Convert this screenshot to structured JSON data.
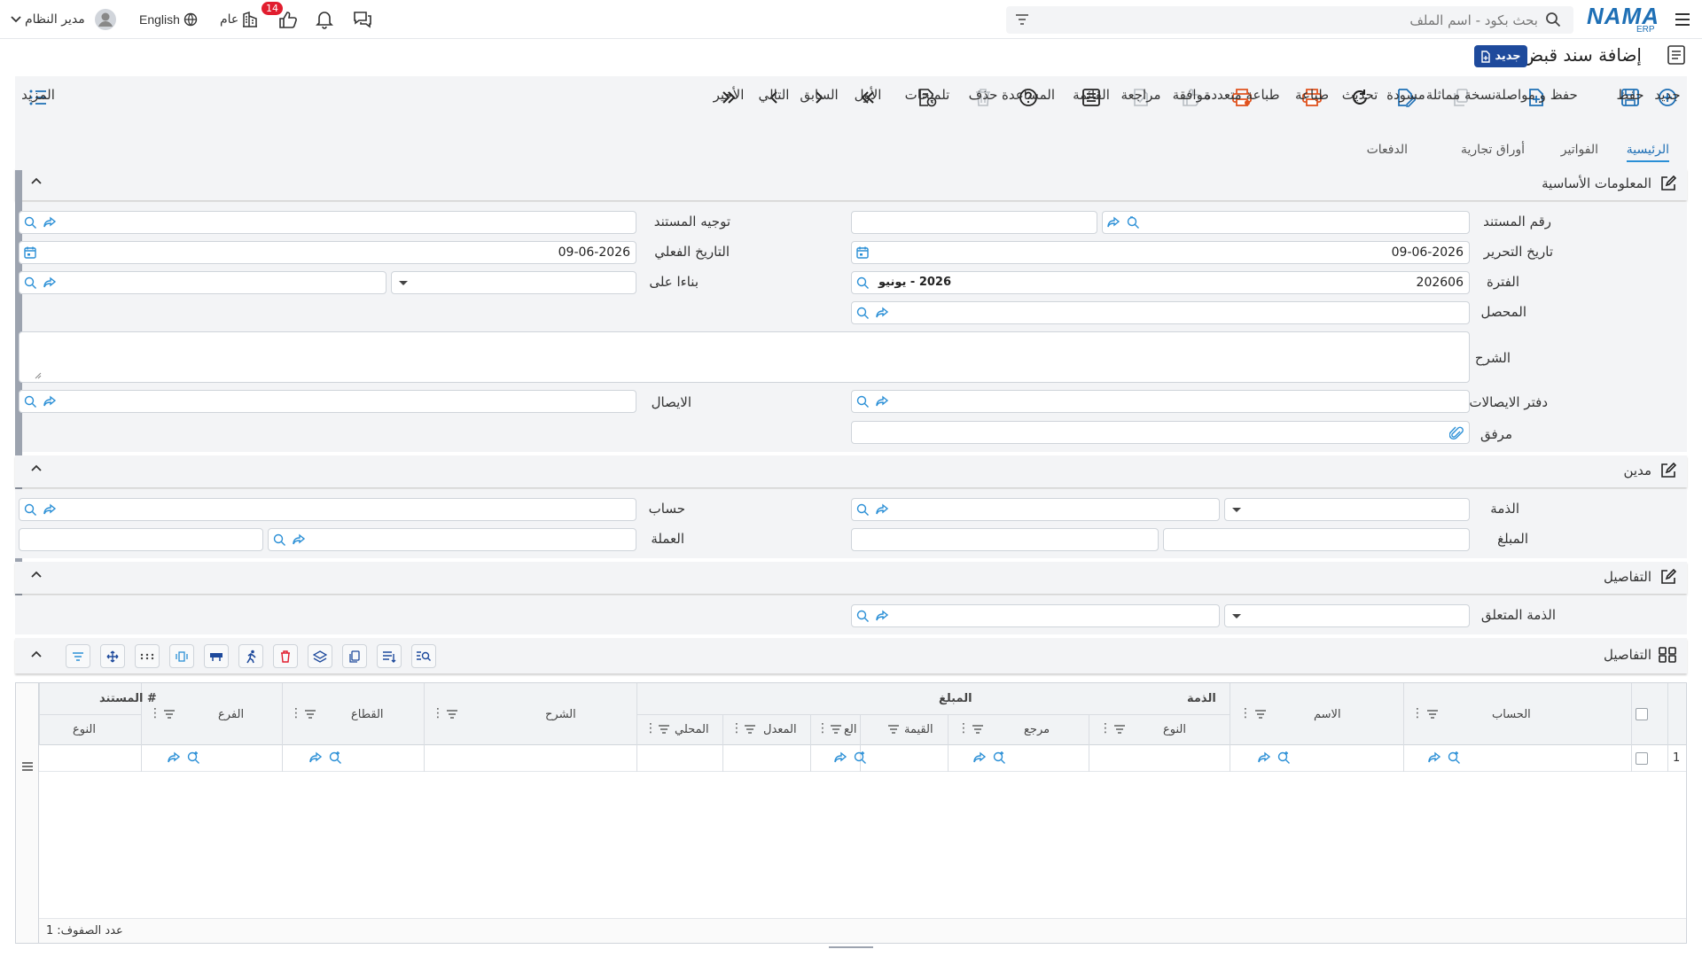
{
  "topbar": {
    "brand": "NAMA",
    "brand_sub": "ERP",
    "search_placeholder": "بحث بكود - اسم الملف",
    "notif_count": "14",
    "year_label": "عام",
    "language": "English",
    "user": "مدير النظام"
  },
  "page": {
    "title": "إضافة سند قبض",
    "status_badge": "جديد"
  },
  "toolbar": {
    "new": "جديد",
    "save": "حفظ",
    "save_continue": "حفظ و مواصلة",
    "duplicate": "نسخة مماثلة",
    "draft": "مسودة",
    "refresh": "تحديث",
    "print": "طباعة",
    "multi_print": "طباعة متعددة",
    "approve": "موافقة",
    "review": "مراجعة",
    "list": "القائمة",
    "help": "المساعدة",
    "delete": "حذف",
    "hints": "تلميحات",
    "first": "الأول",
    "previous": "السابق",
    "next": "التالي",
    "last": "الأخير",
    "more": "المزيد"
  },
  "tabs": [
    "الرئيسية",
    "الفواتير",
    "أوراق تجارية",
    "الدفعات"
  ],
  "sections": {
    "basic": "المعلومات الأساسية",
    "debtor": "مدين",
    "details": "التفاصيل",
    "details_grid": "التفاصيل"
  },
  "form": {
    "doc_number": "رقم المستند",
    "doc_direction": "توجيه المستند",
    "edit_date": "تاريخ التحرير",
    "edit_date_value": "09-06-2026",
    "actual_date": "التاريخ الفعلي",
    "actual_date_value": "09-06-2026",
    "period": "الفترة",
    "period_value": "202606",
    "period_name": "2026 - يونيو",
    "based_on": "بناءا على",
    "collector": "المحصل",
    "description": "الشرح",
    "receipts_book": "دفتر الايصالات",
    "receipt": "الايصال",
    "attachment": "مرفق",
    "subsidiary": "الذمة",
    "account": "حساب",
    "amount": "المبلغ",
    "currency": "العملة",
    "related_subsidiary": "الذمة المتعلق"
  },
  "grid": {
    "headers": {
      "account": "الحساب",
      "name": "الاسم",
      "subsidiary_group": "الذمة",
      "type": "النوع",
      "ref": "مرجع",
      "amount_group": "المبلغ",
      "value": "القيمة",
      "currency_short": "الع",
      "rate": "المعدل",
      "local": "المحلي",
      "description": "الشرح",
      "sector": "القطاع",
      "branch": "الفرع",
      "doc_group": "# المستند",
      "doc_type": "النوع"
    },
    "rows": [
      {
        "index": "1"
      }
    ],
    "row_count_label": "عدد الصفوف:",
    "row_count": "1"
  },
  "colors": {
    "brand": "#1e6fb5",
    "accent_blue": "#1e4a9c",
    "print_orange": "#e0531f",
    "delete_red": "#e11d2e",
    "link_blue": "#2a8fd6"
  }
}
